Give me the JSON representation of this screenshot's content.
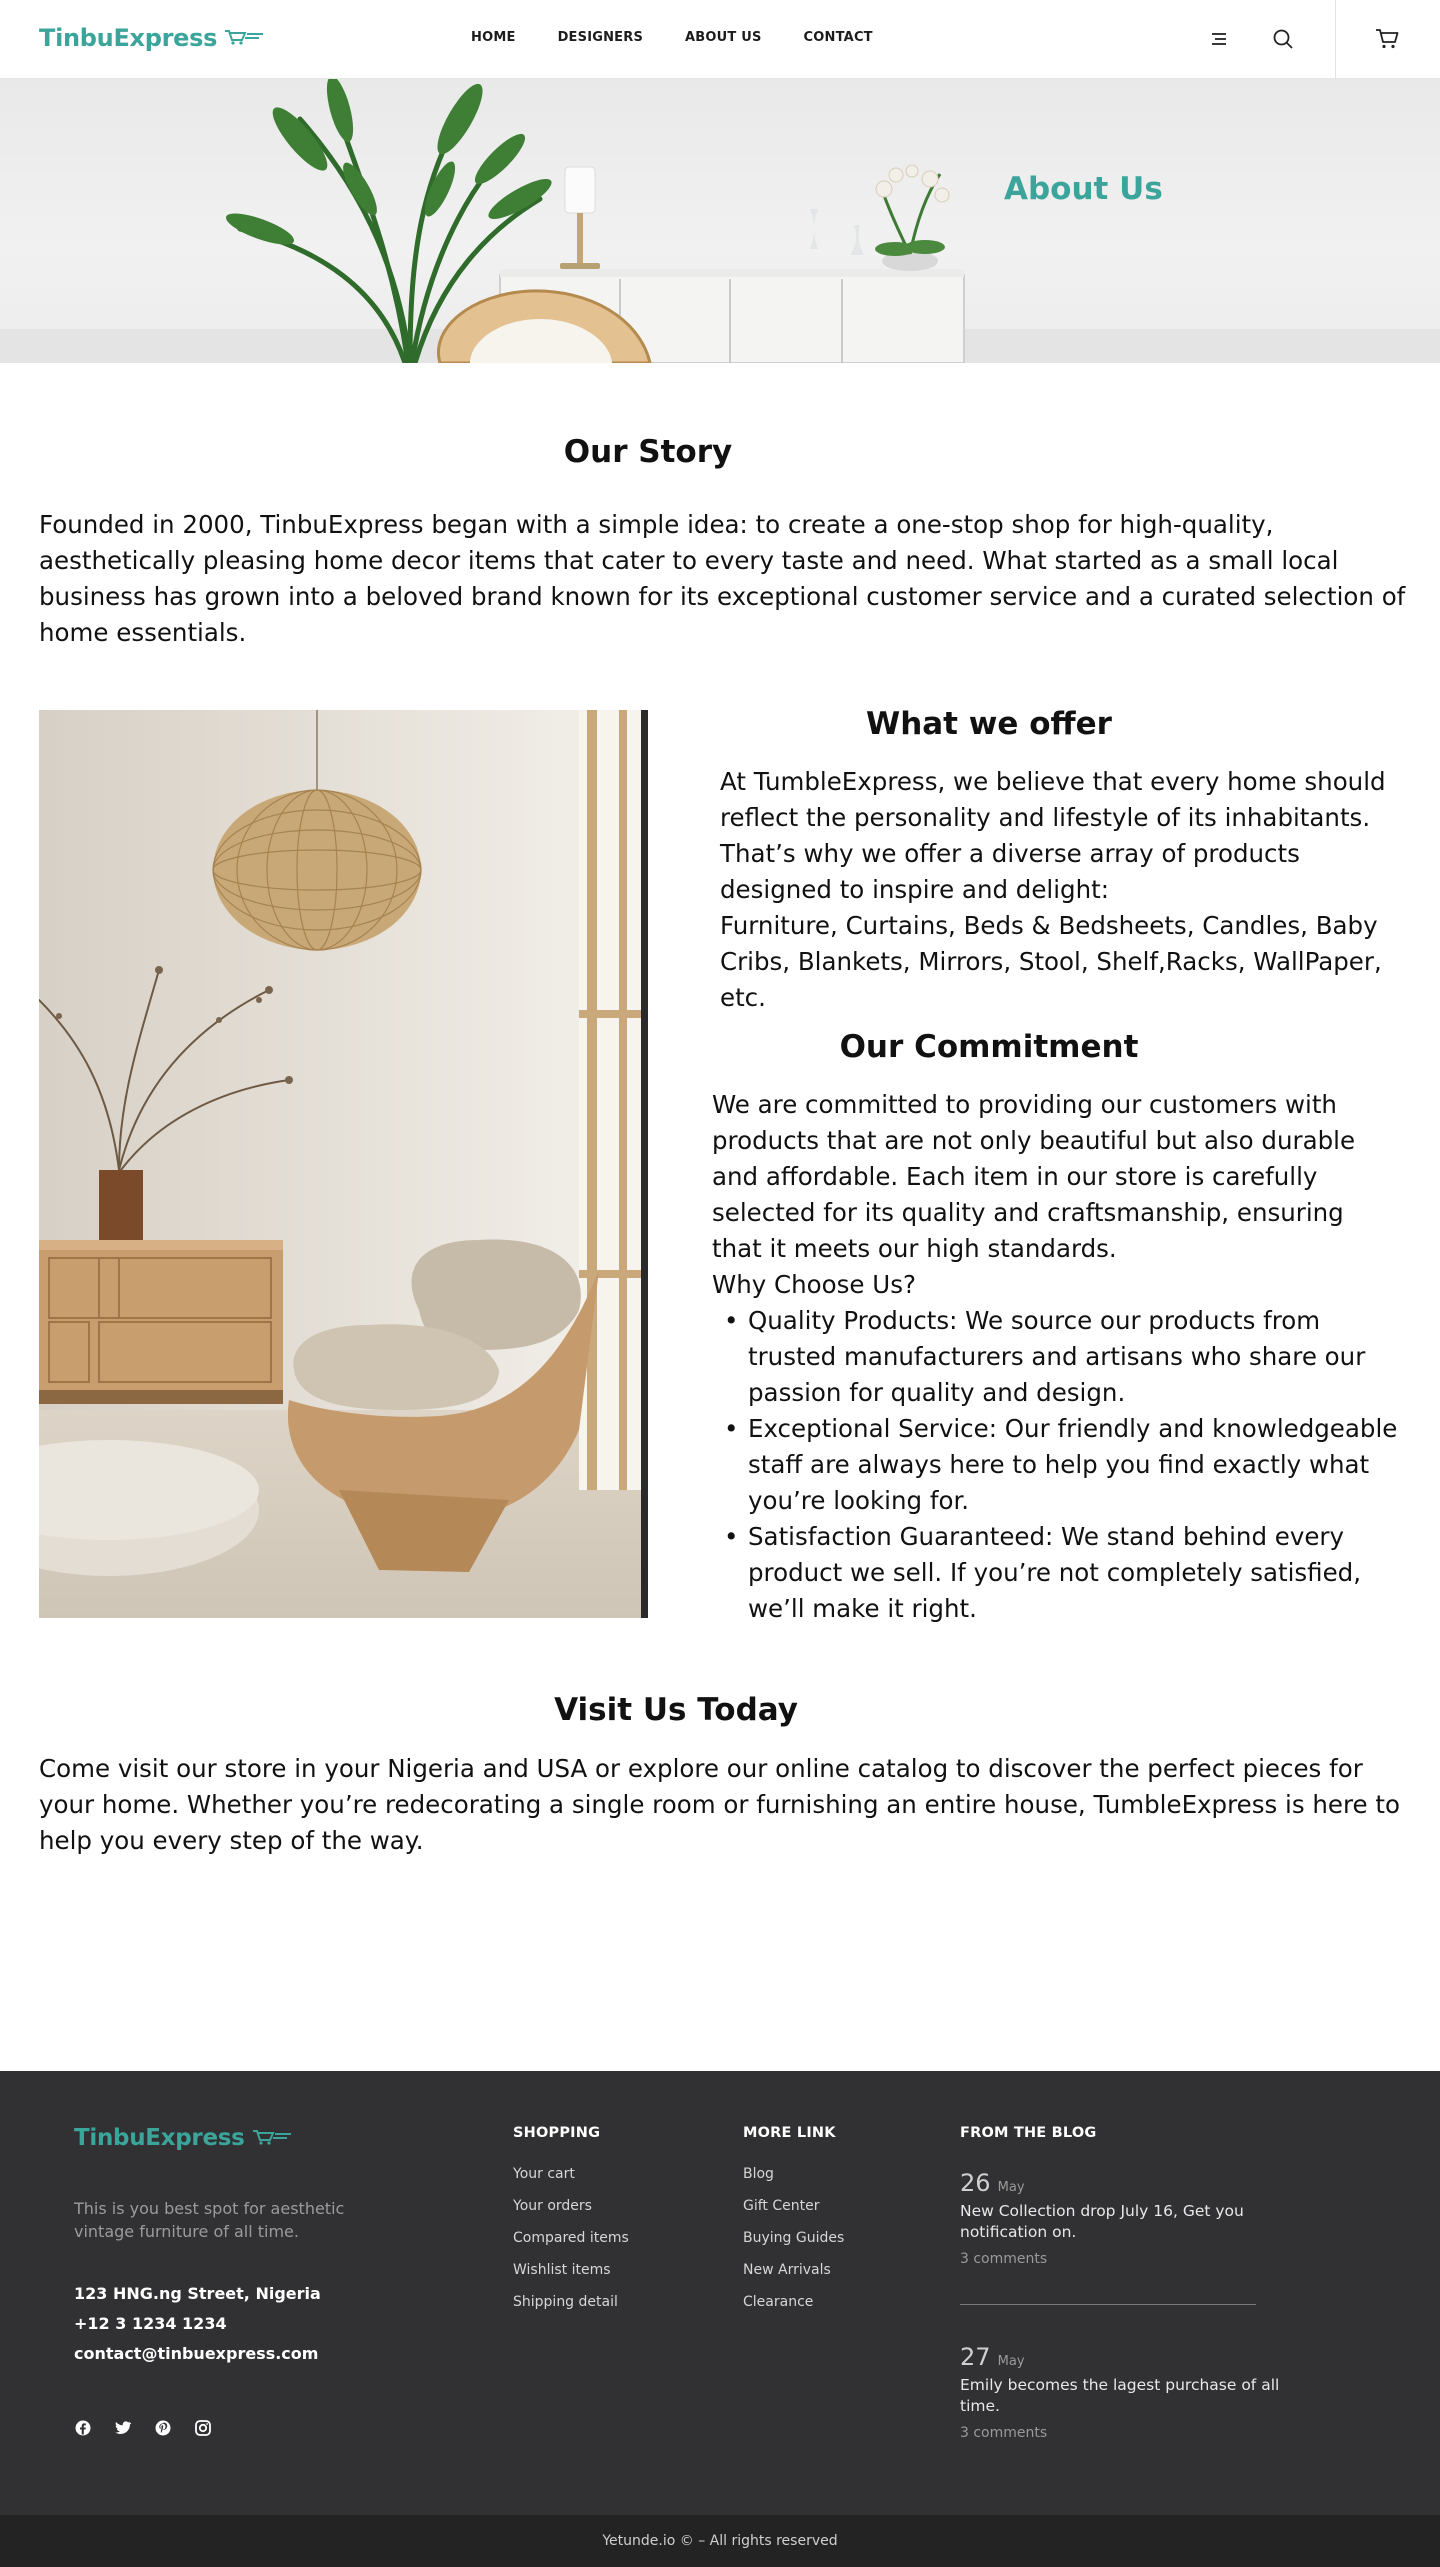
{
  "brand": {
    "name": "TinbuExpress",
    "accent_color": "#3ba59b",
    "logo_icon": "shopping-cart-speed-icon"
  },
  "nav": {
    "items": [
      {
        "label": "HOME"
      },
      {
        "label": "DESIGNERS"
      },
      {
        "label": "ABOUT US"
      },
      {
        "label": "CONTACT"
      }
    ],
    "icons": [
      "menu-icon",
      "search-icon",
      "cart-icon"
    ]
  },
  "hero": {
    "title": "About Us"
  },
  "story": {
    "title": "Our Story",
    "text": "Founded in 2000, TinbuExpress began with a simple idea: to create a one-stop shop for high-quality, aesthetically pleasing home decor items that cater to every taste and need. What started as a small local business has grown into a beloved brand known for its exceptional customer service and a curated selection of home essentials."
  },
  "offer": {
    "title": "What we offer",
    "text": "At TumbleExpress, we believe that every home should reflect the personality and lifestyle of its inhabitants. That’s why we offer a diverse array of products designed to inspire and delight:",
    "items": "Furniture, Curtains, Beds & Bedsheets, Candles, Baby Cribs, Blankets, Mirrors, Stool, Shelf,Racks, WallPaper, etc."
  },
  "commitment": {
    "title": "Our Commitment",
    "text": "We are committed to providing our customers with products that are not only beautiful but also durable and affordable. Each item in our store is carefully selected for its quality and craftsmanship, ensuring that it meets our high standards.",
    "why_title": "Why Choose Us?",
    "reasons": [
      "Quality Products: We source our products from trusted manufacturers and artisans who share our passion for quality and design.",
      "Exceptional Service: Our friendly and knowledgeable staff are always here to help you find exactly what you’re looking for.",
      "Satisfaction Guaranteed: We stand behind every product we sell. If you’re not completely satisfied, we’ll make it right."
    ]
  },
  "visit": {
    "title": "Visit Us Today",
    "text": "Come visit our store in your Nigeria and USA or explore our online catalog to discover the perfect pieces for your home. Whether you’re redecorating a single room or furnishing an entire house, TumbleExpress is here to help you every step of the way."
  },
  "footer": {
    "tagline": "This is you best spot for aesthetic vintage furniture of all time.",
    "address": "123 HNG.ng Street, Nigeria",
    "phone": "+12 3 1234 1234",
    "email": "contact@tinbuexpress.com",
    "social_icons": [
      "facebook-icon",
      "twitter-icon",
      "pinterest-icon",
      "instagram-icon"
    ],
    "shopping": {
      "title": "SHOPPING",
      "links": [
        "Your cart",
        "Your orders",
        "Compared items",
        "Wishlist items",
        "Shipping detail"
      ]
    },
    "more": {
      "title": "MORE LINK",
      "links": [
        "Blog",
        "Gift Center",
        "Buying Guides",
        "New Arrivals",
        "Clearance"
      ]
    },
    "blog": {
      "title": "FROM THE BLOG",
      "posts": [
        {
          "day": "26",
          "month": "May",
          "title": "New Collection drop July 16, Get you notification on.",
          "comments": "3 comments"
        },
        {
          "day": "27",
          "month": "May",
          "title": "Emily becomes the lagest purchase of all time.",
          "comments": "3 comments"
        }
      ]
    },
    "copyright": "Yetunde.io  © – All rights reserved",
    "background": "#313133",
    "bottom_bar": "#232323"
  }
}
